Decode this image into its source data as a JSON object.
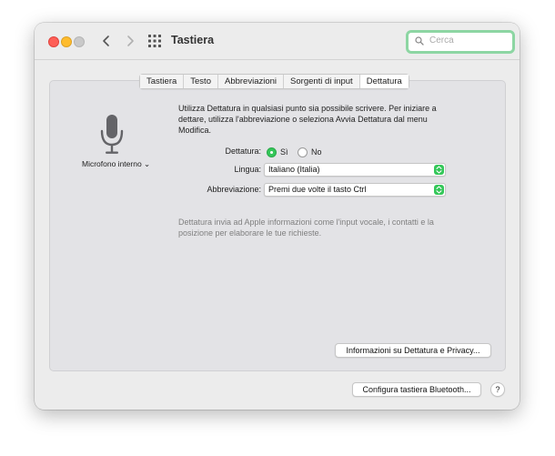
{
  "window": {
    "title": "Tastiera"
  },
  "search": {
    "placeholder": "Cerca"
  },
  "tabs": [
    {
      "label": "Tastiera",
      "active": false
    },
    {
      "label": "Testo",
      "active": false
    },
    {
      "label": "Abbreviazioni",
      "active": false
    },
    {
      "label": "Sorgenti di input",
      "active": false
    },
    {
      "label": "Dettatura",
      "active": true
    }
  ],
  "dictation": {
    "description": "Utilizza Dettatura in qualsiasi punto sia possibile scrivere. Per iniziare a dettare, utilizza l'abbreviazione o seleziona Avvia Dettatura dal menu Modifica.",
    "microphone_label": "Microfono interno ⌄",
    "dictation_label": "Dettatura:",
    "option_on": "Sì",
    "option_off": "No",
    "language_label": "Lingua:",
    "language_value": "Italiano (Italia)",
    "shortcut_label": "Abbreviazione:",
    "shortcut_value": "Premi due volte il tasto Ctrl",
    "privacy_note": "Dettatura invia ad Apple informazioni come l'input vocale, i contatti e la posizione per elaborare le tue richieste.",
    "privacy_button": "Informazioni su Dettatura e Privacy...",
    "selected_option": "Sì"
  },
  "footer": {
    "bluetooth_button": "Configura tastiera Bluetooth...",
    "help_button": "?"
  },
  "colors": {
    "accent_green": "#34c759",
    "search_focus_ring": "#8dd6a3"
  },
  "icons": [
    "back-arrow-icon",
    "forward-arrow-icon",
    "grid-icon",
    "search-icon",
    "microphone-icon",
    "stepper-arrows-icon"
  ]
}
